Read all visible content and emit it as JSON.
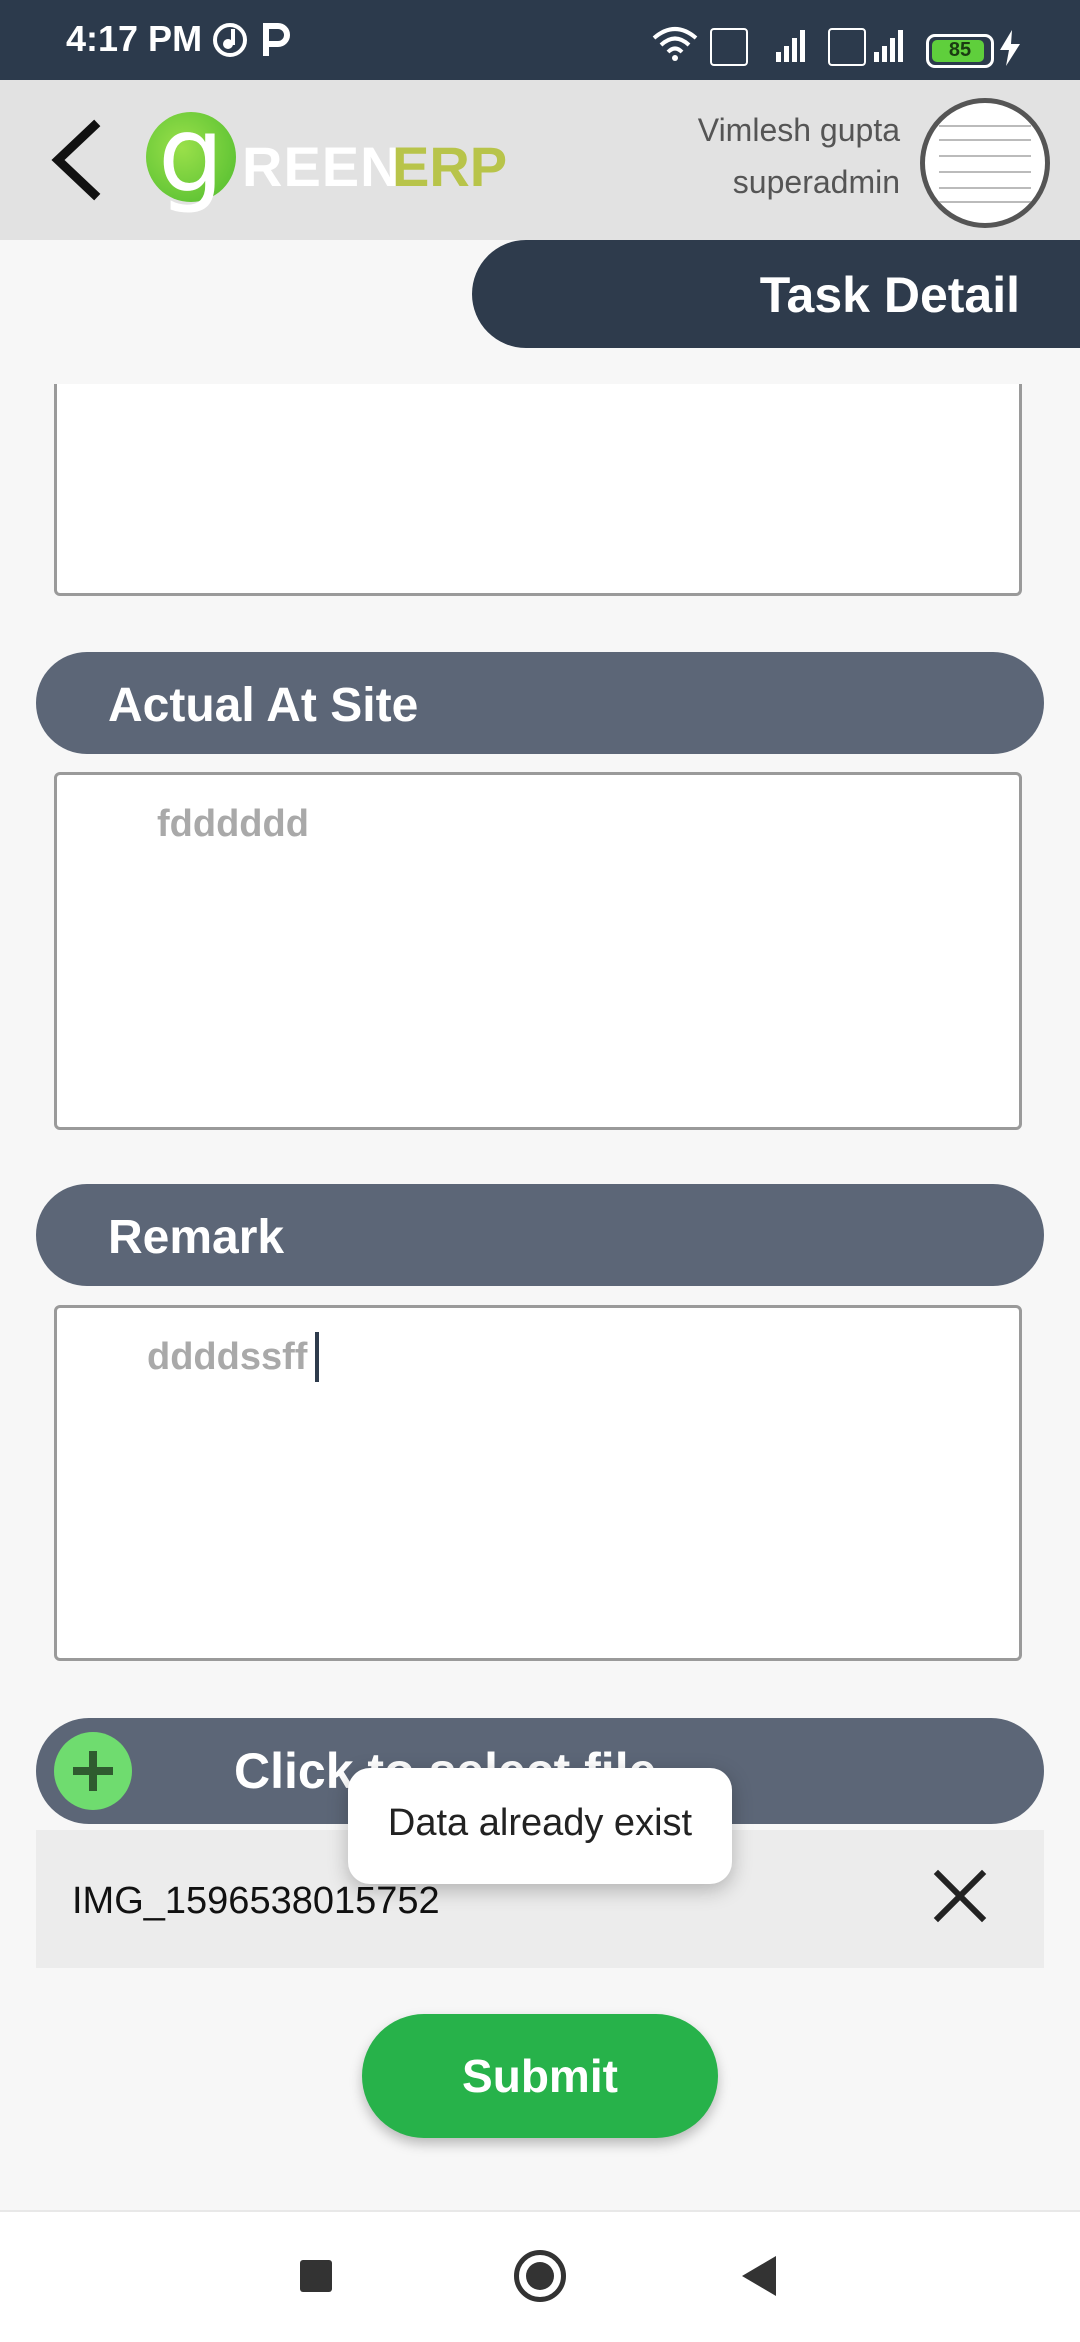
{
  "status_bar": {
    "time": "4:17 PM",
    "battery": "85",
    "icons": [
      "music-app-icon",
      "p-app-icon",
      "wifi-icon",
      "volte-icon",
      "4g-signal-icon",
      "volte-icon",
      "signal-icon",
      "battery-icon",
      "charging-icon"
    ]
  },
  "header": {
    "logo_g": "g",
    "logo_reen": "REEN",
    "logo_erp": "ERP",
    "user_name": "Vimlesh gupta",
    "user_role": "superadmin"
  },
  "page": {
    "tab_title": "Task Detail"
  },
  "sections": {
    "actual_at_site": {
      "label": "Actual At Site",
      "value": "fdddddd"
    },
    "remark": {
      "label": "Remark",
      "value": "ddddssff"
    }
  },
  "file": {
    "select_label": "Click to select file",
    "selected_name": "IMG_1596538015752"
  },
  "toast": {
    "message": "Data already exist"
  },
  "submit_label": "Submit",
  "colors": {
    "status_bar": "#2c3a4c",
    "section_header": "#5c6677",
    "submit": "#27b24a",
    "accent_green": "#6fdc6f"
  }
}
